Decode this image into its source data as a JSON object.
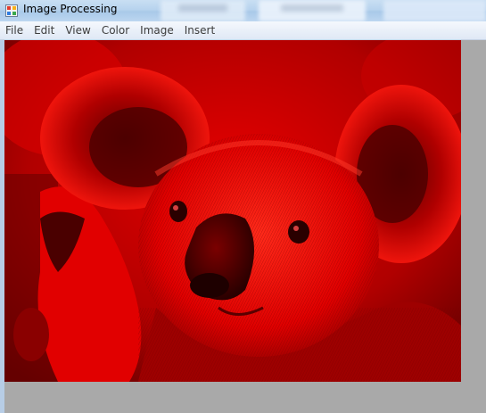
{
  "window": {
    "title": "Image Processing"
  },
  "menu": {
    "items": [
      {
        "label": "File"
      },
      {
        "label": "Edit"
      },
      {
        "label": "View"
      },
      {
        "label": "Color"
      },
      {
        "label": "Image"
      },
      {
        "label": "Insert"
      }
    ]
  },
  "canvas": {
    "subject": "koala",
    "filter": "red channel",
    "colors": {
      "tint": "#ff0000",
      "shadow": "#5a0000",
      "background": "#a9a9a9"
    }
  }
}
